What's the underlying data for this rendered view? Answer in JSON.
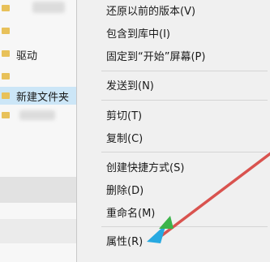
{
  "explorer": {
    "items": [
      {
        "label": "驱动"
      },
      {
        "label": "新建文件夹"
      }
    ]
  },
  "context_menu": {
    "items": [
      {
        "label": "还原以前的版本(V)"
      },
      {
        "label": "包含到库中(I)"
      },
      {
        "label": "固定到“开始”屏幕(P)"
      },
      {
        "label": "发送到(N)"
      },
      {
        "label": "剪切(T)"
      },
      {
        "label": "复制(C)"
      },
      {
        "label": "创建快捷方式(S)"
      },
      {
        "label": "删除(D)"
      },
      {
        "label": "重命名(M)"
      },
      {
        "label": "属性(R)"
      }
    ]
  },
  "colors": {
    "annotation_arrow": "#d9534f",
    "selection_highlight": "#cce6f7",
    "menu_background": "#f0f0f0"
  }
}
